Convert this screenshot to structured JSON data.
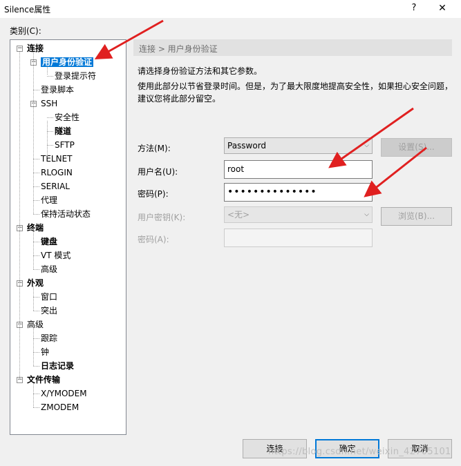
{
  "window": {
    "title": "Silence属性",
    "help_glyph": "?",
    "close_glyph": "✕"
  },
  "category_label": "类别(C):",
  "tree": [
    {
      "label": "连接",
      "toggle": "−",
      "bold": true
    },
    {
      "label": "用户身份验证",
      "toggle": "−",
      "bold": true,
      "selected": true
    },
    {
      "label": "登录提示符"
    },
    {
      "label": "登录脚本"
    },
    {
      "label": "SSH",
      "toggle": "−"
    },
    {
      "label": "安全性"
    },
    {
      "label": "隧道",
      "bold": true
    },
    {
      "label": "SFTP"
    },
    {
      "label": "TELNET"
    },
    {
      "label": "RLOGIN"
    },
    {
      "label": "SERIAL"
    },
    {
      "label": "代理"
    },
    {
      "label": "保持活动状态"
    },
    {
      "label": "终端",
      "toggle": "−",
      "bold": true
    },
    {
      "label": "键盘",
      "bold": true
    },
    {
      "label": "VT 模式"
    },
    {
      "label": "高级"
    },
    {
      "label": "外观",
      "toggle": "−",
      "bold": true
    },
    {
      "label": "窗口"
    },
    {
      "label": "突出"
    },
    {
      "label": "高级",
      "toggle": "−"
    },
    {
      "label": "跟踪"
    },
    {
      "label": "钟"
    },
    {
      "label": "日志记录",
      "bold": true
    },
    {
      "label": "文件传输",
      "toggle": "−",
      "bold": true
    },
    {
      "label": "X/YMODEM"
    },
    {
      "label": "ZMODEM"
    }
  ],
  "breadcrumb": "连接 > 用户身份验证",
  "description": {
    "line1": "请选择身份验证方法和其它参数。",
    "line2": "使用此部分以节省登录时间。但是，为了最大限度地提高安全性，如果担心安全问题，建议您将此部分留空。"
  },
  "form": {
    "method_label": "方法(M):",
    "method_value": "Password",
    "settings_button": "设置(S)...",
    "username_label": "用户名(U):",
    "username_value": "root",
    "password_label": "密码(P):",
    "password_value": "••••••••••••••",
    "userkey_label": "用户密钥(K):",
    "userkey_value": "<无>",
    "browse_button": "浏览(B)...",
    "passphrase_label": "密码(A):",
    "passphrase_value": ""
  },
  "buttons": {
    "connect": "连接",
    "ok": "确定",
    "cancel": "取消"
  },
  "watermark": "https://blog.csdn.net/weixin_42705101",
  "colors": {
    "selection": "#0078d7",
    "annotation_arrow": "#e02020"
  }
}
